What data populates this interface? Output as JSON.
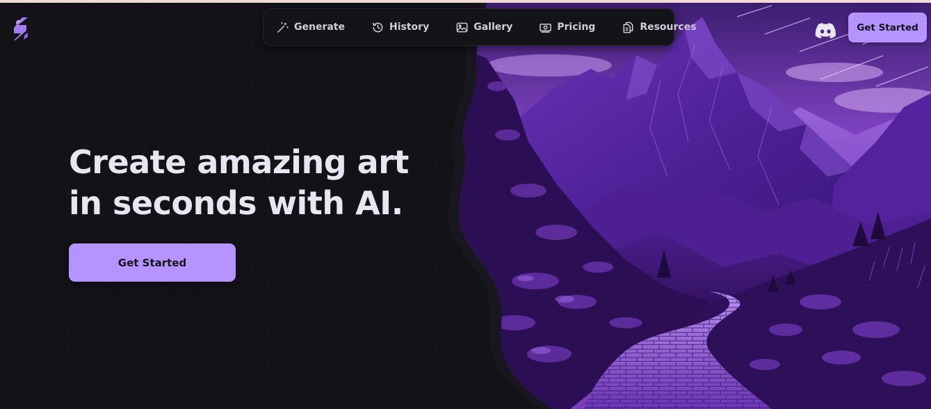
{
  "nav": {
    "items": [
      {
        "label": "Generate",
        "icon": "magic-wand-icon"
      },
      {
        "label": "History",
        "icon": "history-clock-icon"
      },
      {
        "label": "Gallery",
        "icon": "image-icon"
      },
      {
        "label": "Pricing",
        "icon": "banknote-icon"
      },
      {
        "label": "Resources",
        "icon": "documents-icon"
      }
    ]
  },
  "header": {
    "logo_icon": "s-logo-icon",
    "discord_icon": "discord-icon",
    "cta_label": "Get Started"
  },
  "hero": {
    "headline": "Create amazing art in seconds with AI.",
    "cta_label": "Get Started",
    "image_description_icon": "purple-mountain-path-illustration"
  },
  "colors": {
    "background": "#131317",
    "accent": "#b594ff",
    "headline": "#e8e6f0",
    "nav_text": "#cfcfd6",
    "top_bar": "#f3dcd6"
  }
}
